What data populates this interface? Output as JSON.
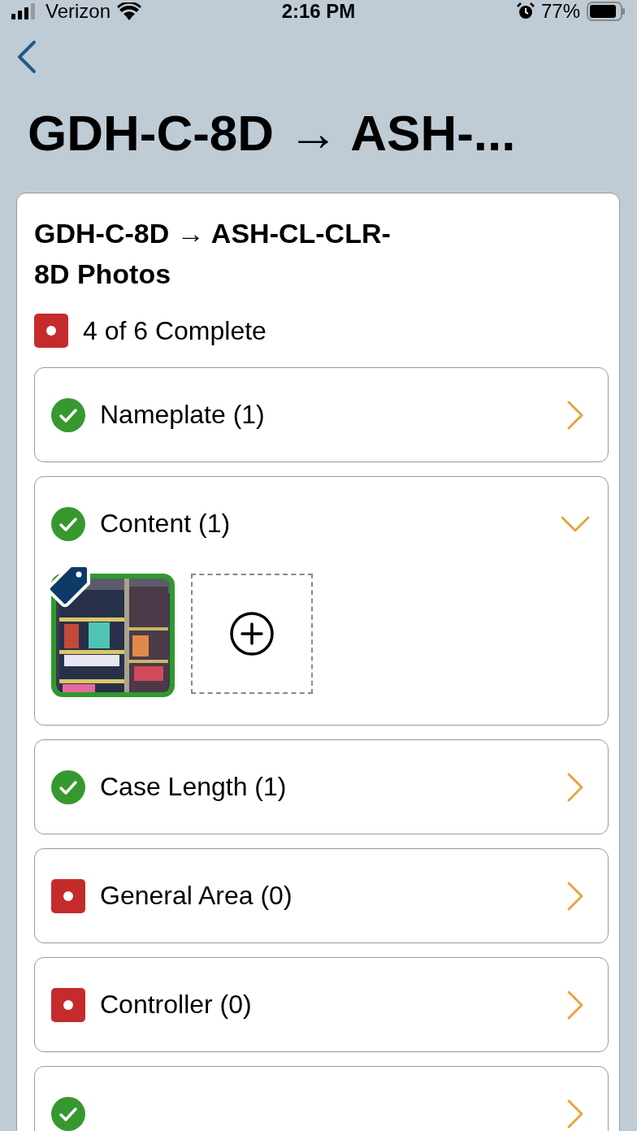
{
  "status_bar": {
    "carrier": "Verizon",
    "time": "2:16 PM",
    "battery": "77%"
  },
  "nav": {
    "title": "GDH-C-8D → ASH-..."
  },
  "card": {
    "title": "GDH-C-8D → ASH-CL-CLR-8D Photos",
    "progress": {
      "complete": false,
      "label": "4 of 6 Complete"
    },
    "sections": [
      {
        "label": "Nameplate (1)",
        "complete": true,
        "expanded": false
      },
      {
        "label": "Content (1)",
        "complete": true,
        "expanded": true,
        "photos": [
          {
            "kind": "picture",
            "tagged": true
          }
        ]
      },
      {
        "label": "Case Length (1)",
        "complete": true,
        "expanded": false
      },
      {
        "label": "General Area (0)",
        "complete": false,
        "expanded": false
      },
      {
        "label": "Controller (0)",
        "complete": false,
        "expanded": false
      },
      {
        "complete": true,
        "expanded": false
      }
    ]
  }
}
